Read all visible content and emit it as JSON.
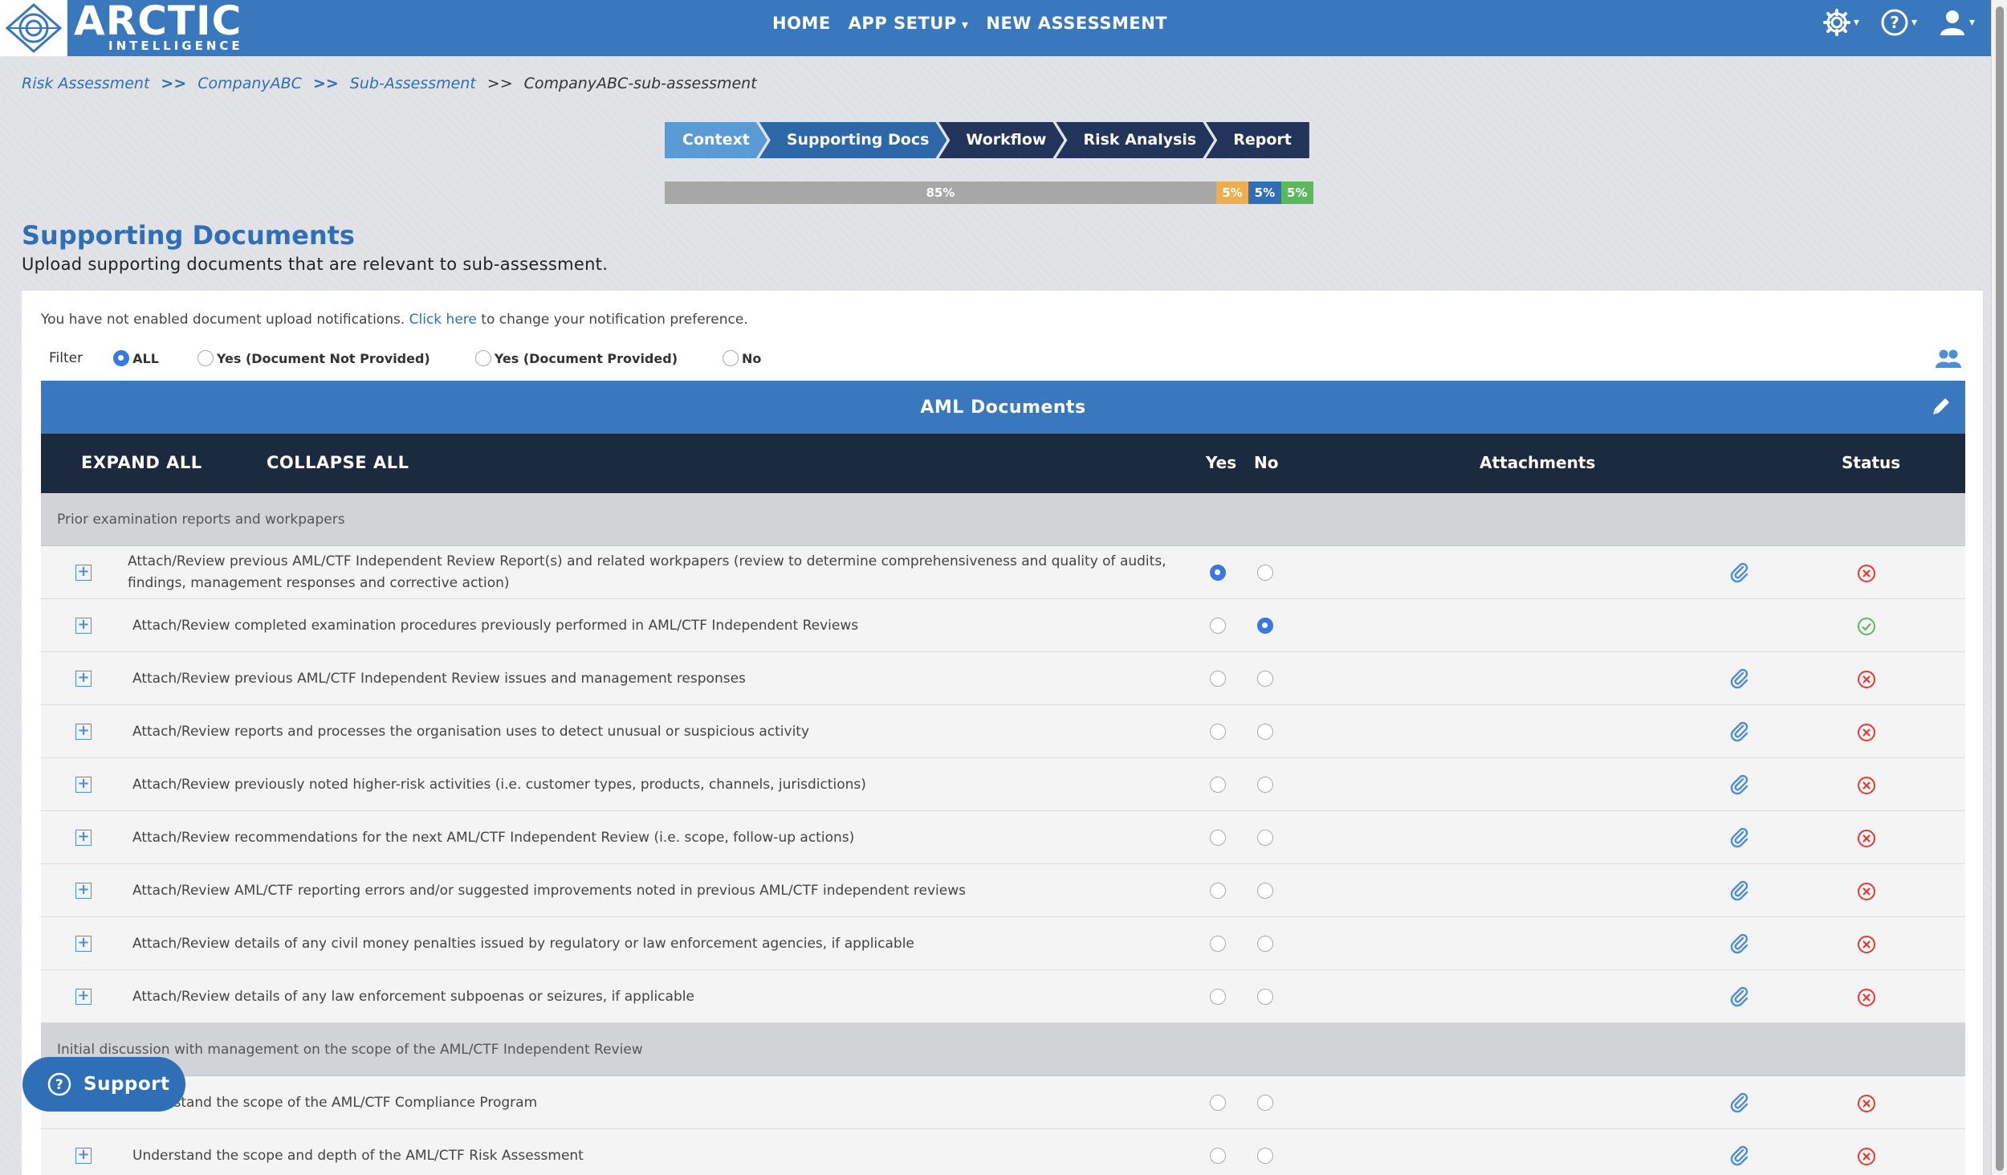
{
  "app": {
    "logo_main": "ARCTIC",
    "logo_sub": "INTELLIGENCE"
  },
  "nav": {
    "items": [
      {
        "label": "HOME"
      },
      {
        "label": "APP SETUP"
      },
      {
        "label": "NEW ASSESSMENT"
      }
    ],
    "icons": [
      "gear-icon",
      "help-icon",
      "user-icon"
    ]
  },
  "breadcrumb": {
    "items": [
      "Risk Assessment",
      "CompanyABC",
      "Sub-Assessment"
    ],
    "separator": ">>",
    "current": "CompanyABC-sub-assessment"
  },
  "steps": [
    "Context",
    "Supporting Docs",
    "Workflow",
    "Risk Analysis",
    "Report"
  ],
  "progress": {
    "segments": [
      {
        "label": "85%",
        "value": 85,
        "color": "#a7a7a7"
      },
      {
        "label": "5%",
        "value": 5,
        "color": "#f0ad4e"
      },
      {
        "label": "5%",
        "value": 5,
        "color": "#2f6fb8"
      },
      {
        "label": "5%",
        "value": 5,
        "color": "#5cb85c"
      }
    ]
  },
  "page": {
    "title": "Supporting Documents",
    "subtitle": "Upload supporting documents that are relevant to sub-assessment."
  },
  "notice": {
    "before": "You have not enabled document upload notifications.",
    "link": "Click here",
    "after": "to change your notification preference."
  },
  "filter": {
    "label": "Filter",
    "options": [
      {
        "label": "ALL",
        "selected": true
      },
      {
        "label": "Yes (Document Not Provided)",
        "selected": false
      },
      {
        "label": "Yes (Document Provided)",
        "selected": false
      },
      {
        "label": "No",
        "selected": false
      }
    ]
  },
  "table": {
    "title": "AML Documents",
    "expand_all": "EXPAND ALL",
    "collapse_all": "COLLAPSE ALL",
    "col_yes": "Yes",
    "col_no": "No",
    "col_attachments": "Attachments",
    "col_status": "Status",
    "sections": [
      {
        "title": "Prior examination reports and workpapers",
        "rows": [
          {
            "text": "Attach/Review previous AML/CTF Independent Review Report(s) and related workpapers (review to determine comprehensiveness and quality of audits, findings, management responses and corrective action)",
            "answer": "yes",
            "attachment": true,
            "status": "incomplete"
          },
          {
            "text": "Attach/Review completed examination procedures previously performed in AML/CTF Independent Reviews",
            "answer": "no",
            "attachment": false,
            "status": "complete"
          },
          {
            "text": "Attach/Review previous AML/CTF Independent Review issues and management responses",
            "answer": "",
            "attachment": true,
            "status": "incomplete"
          },
          {
            "text": "Attach/Review reports and processes the organisation uses to detect unusual or suspicious activity",
            "answer": "",
            "attachment": true,
            "status": "incomplete"
          },
          {
            "text": "Attach/Review previously noted higher-risk activities (i.e. customer types, products, channels, jurisdictions)",
            "answer": "",
            "attachment": true,
            "status": "incomplete"
          },
          {
            "text": "Attach/Review recommendations for the next AML/CTF Independent Review (i.e. scope, follow-up actions)",
            "answer": "",
            "attachment": true,
            "status": "incomplete"
          },
          {
            "text": "Attach/Review AML/CTF reporting errors and/or suggested improvements noted in previous AML/CTF independent reviews",
            "answer": "",
            "attachment": true,
            "status": "incomplete"
          },
          {
            "text": "Attach/Review details of any civil money penalties issued by regulatory or law enforcement agencies, if applicable",
            "answer": "",
            "attachment": true,
            "status": "incomplete"
          },
          {
            "text": "Attach/Review details of any law enforcement subpoenas or seizures, if applicable",
            "answer": "",
            "attachment": true,
            "status": "incomplete"
          }
        ]
      },
      {
        "title": "Initial discussion with management on the scope of the AML/CTF Independent Review",
        "rows": [
          {
            "text": "Understand the scope of the AML/CTF Compliance Program",
            "answer": "",
            "attachment": true,
            "status": "incomplete"
          },
          {
            "text": "Understand the scope and depth of the AML/CTF Risk Assessment",
            "answer": "",
            "attachment": true,
            "status": "incomplete"
          }
        ]
      }
    ]
  },
  "support": {
    "label": "Support"
  },
  "colors": {
    "brand": "#3a78bd",
    "dark_header": "#1c2a40",
    "status_incomplete": "#e53935",
    "status_complete": "#5cb85c"
  }
}
